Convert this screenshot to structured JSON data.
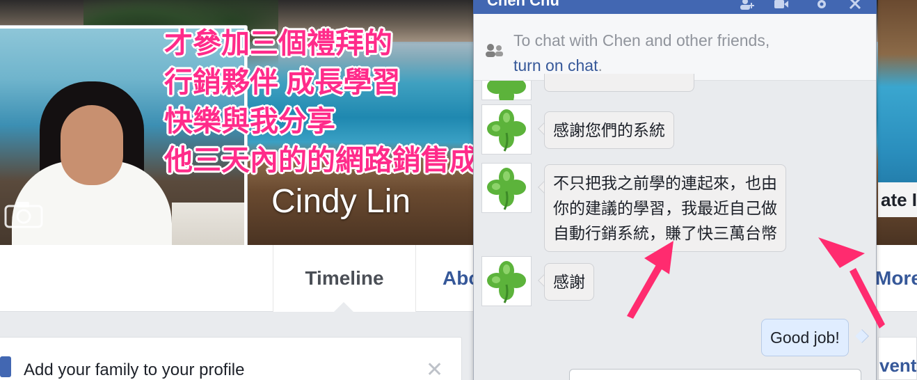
{
  "profile": {
    "name": "Cindy Lin",
    "cover_right_label": "ate In"
  },
  "tabs": {
    "timeline": "Timeline",
    "about": "Abo",
    "more": "More"
  },
  "family_card": {
    "text": "Add your family to your profile",
    "close": "✕"
  },
  "event_card": {
    "text": "vent"
  },
  "annotation": {
    "lines": [
      "才參加三個禮拜的",
      "行銷夥伴 成長學習",
      "快樂與我分享",
      "他三天內的的網路銷售成績"
    ],
    "color": "#ff2b8a"
  },
  "chat": {
    "title": "Chen Chu",
    "notice_text": "To chat with Chen and other friends,",
    "notice_link": "turn on chat",
    "notice_period": ".",
    "messages": [
      {
        "from": "Chen",
        "text": "感謝您們的系統"
      },
      {
        "from": "Chen",
        "lines": [
          "不只把我之前學的連起來，也由",
          "你的建議的學習，我最近自己做",
          "自動行銷系統，賺了快三萬台幣"
        ]
      },
      {
        "from": "Chen",
        "text": "感謝"
      },
      {
        "from": "Me",
        "text": "Good job!"
      }
    ],
    "header_color": "#4267b2",
    "avatar_icon": "four-leaf-clover-icon"
  },
  "colors": {
    "link": "#365899",
    "arrow": "#ff2b6f"
  }
}
